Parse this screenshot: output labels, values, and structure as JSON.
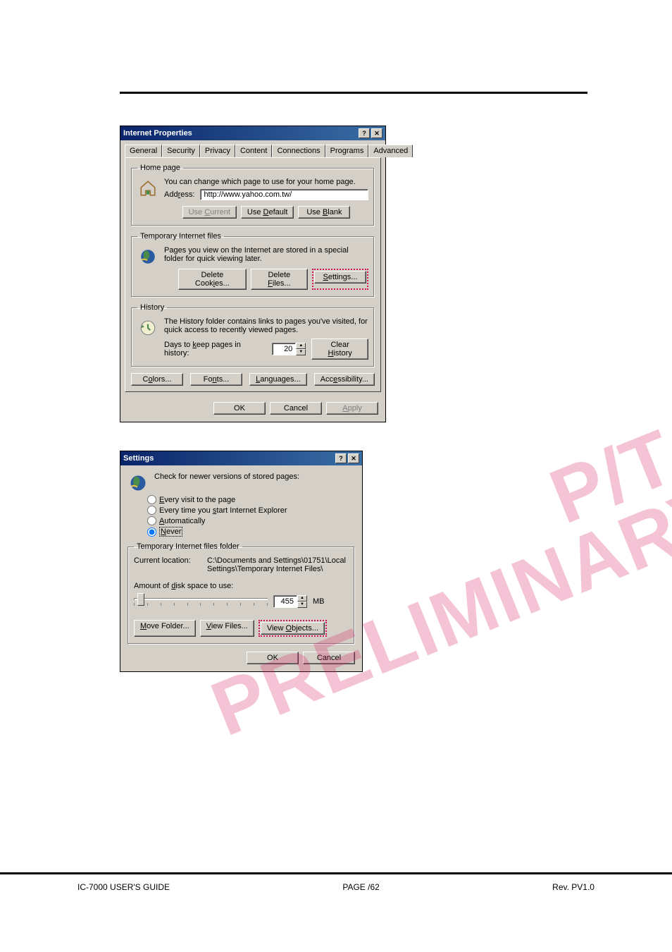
{
  "footer": {
    "left": "IC-7000 USER'S GUIDE",
    "center": "PAGE   /62",
    "right": "Rev. PV1.0"
  },
  "watermark": {
    "line1": "P/T",
    "line2": "PRELIMINARY"
  },
  "dialog1": {
    "title": "Internet Properties",
    "tabs": [
      "General",
      "Security",
      "Privacy",
      "Content",
      "Connections",
      "Programs",
      "Advanced"
    ],
    "homepage": {
      "legend": "Home page",
      "text": "You can change which page to use for your home page.",
      "addr_label": "Address:",
      "addr_value": "http://www.yahoo.com.tw/",
      "btn_current": "Use Current",
      "btn_default": "Use Default",
      "btn_blank": "Use Blank"
    },
    "temp": {
      "legend": "Temporary Internet files",
      "text": "Pages you view on the Internet are stored in a special folder for quick viewing later.",
      "btn_cookies": "Delete Cookies...",
      "btn_files": "Delete Files...",
      "btn_settings": "Settings..."
    },
    "history": {
      "legend": "History",
      "text": "The History folder contains links to pages you've visited, for quick access to recently viewed pages.",
      "days_label": "Days to keep pages in history:",
      "days_value": "20",
      "btn_clear": "Clear History"
    },
    "bottom": {
      "colors": "Colors...",
      "fonts": "Fonts...",
      "languages": "Languages...",
      "accessibility": "Accessibility..."
    },
    "main_btns": {
      "ok": "OK",
      "cancel": "Cancel",
      "apply": "Apply"
    }
  },
  "dialog2": {
    "title": "Settings",
    "check_label": "Check for newer versions of stored pages:",
    "radios": {
      "every_visit": "Every visit to the page",
      "every_start": "Every time you start Internet Explorer",
      "automatically": "Automatically",
      "never": "Never"
    },
    "folder": {
      "legend": "Temporary Internet files folder",
      "loc_label": "Current location:",
      "loc_value": "C:\\Documents and Settings\\01751\\Local Settings\\Temporary Internet Files\\",
      "disk_label": "Amount of disk space to use:",
      "disk_value": "455",
      "disk_unit": "MB",
      "btn_move": "Move Folder...",
      "btn_view_files": "View Files...",
      "btn_view_objects": "View Objects..."
    },
    "main_btns": {
      "ok": "OK",
      "cancel": "Cancel"
    }
  }
}
